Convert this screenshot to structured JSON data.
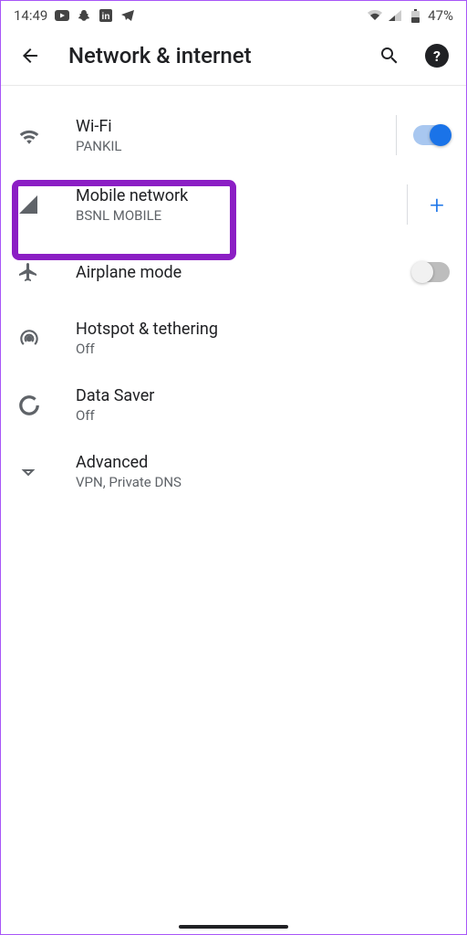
{
  "status": {
    "time": "14:49",
    "battery": "47%"
  },
  "header": {
    "title": "Network & internet"
  },
  "items": {
    "wifi": {
      "title": "Wi-Fi",
      "subtitle": "PANKIL"
    },
    "mobile": {
      "title": "Mobile network",
      "subtitle": "BSNL MOBILE"
    },
    "airplane": {
      "title": "Airplane mode"
    },
    "hotspot": {
      "title": "Hotspot & tethering",
      "subtitle": "Off"
    },
    "datasaver": {
      "title": "Data Saver",
      "subtitle": "Off"
    },
    "advanced": {
      "title": "Advanced",
      "subtitle": "VPN, Private DNS"
    }
  }
}
